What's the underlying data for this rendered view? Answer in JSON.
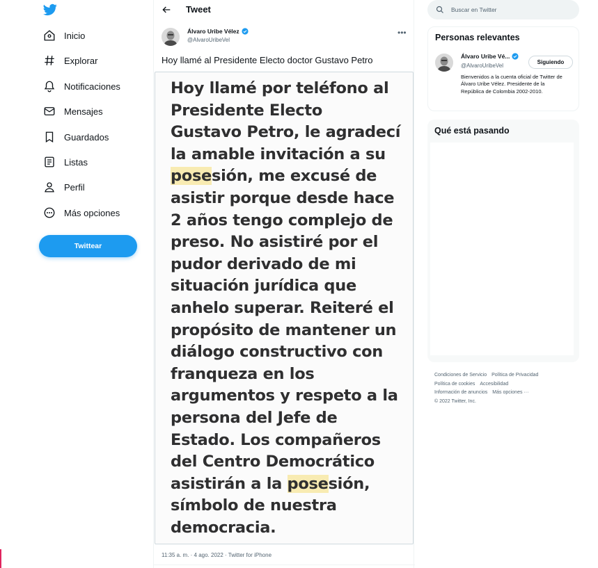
{
  "colors": {
    "accent": "#1d9bf0",
    "text": "#0f1419",
    "secondary": "#536471",
    "highlight": "#f8ebb2"
  },
  "nav": {
    "logo": "twitter-bird-icon",
    "items": [
      {
        "label": "Inicio",
        "icon": "home-icon"
      },
      {
        "label": "Explorar",
        "icon": "hashtag-icon"
      },
      {
        "label": "Notificaciones",
        "icon": "bell-icon"
      },
      {
        "label": "Mensajes",
        "icon": "envelope-icon"
      },
      {
        "label": "Guardados",
        "icon": "bookmark-icon"
      },
      {
        "label": "Listas",
        "icon": "list-icon"
      },
      {
        "label": "Perfil",
        "icon": "person-icon"
      },
      {
        "label": "Más opciones",
        "icon": "more-circle-icon"
      }
    ],
    "tweet_button": "Twittear"
  },
  "header": {
    "title": "Tweet"
  },
  "tweet": {
    "author_name": "Álvaro Uribe Vélez",
    "author_handle": "@AlvaroUribeVel",
    "text": "Hoy llamé al Presidente Electo doctor Gustavo Petro",
    "media_lines": [
      "Hoy llamé por teléfono al",
      "Presidente Electo",
      "Gustavo Petro, le agradecí",
      "la amable invitación a su",
      "posesión, me excusé de",
      "asistir porque desde hace",
      "2 años tengo complejo de",
      "preso. No asistiré por el",
      "pudor derivado de mi",
      "situación jurídica que",
      "anhelo superar. Reiteré el",
      "propósito de mantener un",
      "diálogo constructivo con",
      "franqueza en los",
      "argumentos y respeto a la",
      "persona del Jefe de",
      "Estado. Los compañeros",
      "del Centro Democrático",
      "asistirán a la posesión,",
      "símbolo de nuestra",
      "democracia."
    ],
    "meta": "11:35 a. m. · 4 ago. 2022 · Twitter for iPhone"
  },
  "search": {
    "placeholder": "Buscar en Twitter"
  },
  "relevant": {
    "title": "Personas relevantes",
    "name": "Álvaro Uribe Vé...",
    "handle": "@AlvaroUribeVel",
    "follow_label": "Siguiendo",
    "bio": "Bienvenidos a la cuenta oficial de Twitter de Álvaro Uribe Vélez. Presidente de la República de Colombia 2002-2010."
  },
  "trends": {
    "title": "Qué está pasando"
  },
  "footer": {
    "links": [
      "Condiciones de Servicio",
      "Política de Privacidad",
      "Política de cookies",
      "Accesibilidad",
      "Información de anuncios",
      "Más opciones ···"
    ],
    "copyright": "© 2022 Twitter, Inc."
  }
}
